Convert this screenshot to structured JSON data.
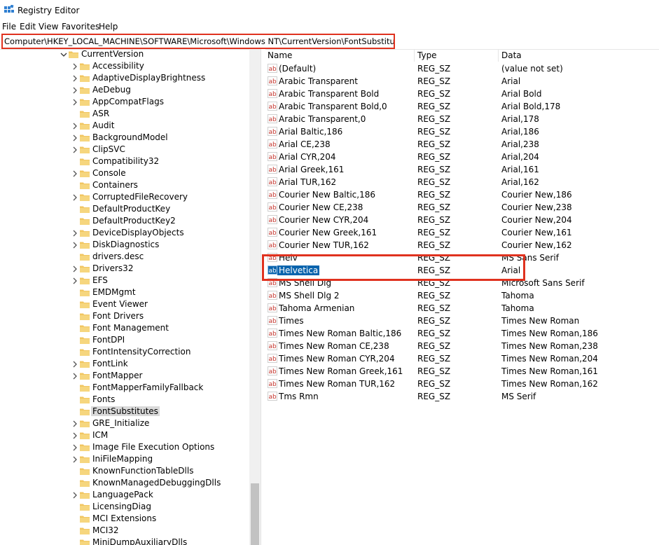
{
  "window": {
    "title": "Registry Editor"
  },
  "menu": [
    "File",
    "Edit",
    "View",
    "Favorites",
    "Help"
  ],
  "address": {
    "path": "Computer\\HKEY_LOCAL_MACHINE\\SOFTWARE\\Microsoft\\Windows NT\\CurrentVersion\\FontSubstitutes"
  },
  "tree": {
    "parent": "CurrentVersion",
    "children": [
      {
        "label": "Accessibility",
        "expandable": true
      },
      {
        "label": "AdaptiveDisplayBrightness",
        "expandable": true
      },
      {
        "label": "AeDebug",
        "expandable": true
      },
      {
        "label": "AppCompatFlags",
        "expandable": true
      },
      {
        "label": "ASR",
        "expandable": false
      },
      {
        "label": "Audit",
        "expandable": true
      },
      {
        "label": "BackgroundModel",
        "expandable": true
      },
      {
        "label": "ClipSVC",
        "expandable": true
      },
      {
        "label": "Compatibility32",
        "expandable": false
      },
      {
        "label": "Console",
        "expandable": true
      },
      {
        "label": "Containers",
        "expandable": false
      },
      {
        "label": "CorruptedFileRecovery",
        "expandable": true
      },
      {
        "label": "DefaultProductKey",
        "expandable": false
      },
      {
        "label": "DefaultProductKey2",
        "expandable": false
      },
      {
        "label": "DeviceDisplayObjects",
        "expandable": true
      },
      {
        "label": "DiskDiagnostics",
        "expandable": true
      },
      {
        "label": "drivers.desc",
        "expandable": false
      },
      {
        "label": "Drivers32",
        "expandable": true
      },
      {
        "label": "EFS",
        "expandable": true
      },
      {
        "label": "EMDMgmt",
        "expandable": false
      },
      {
        "label": "Event Viewer",
        "expandable": false
      },
      {
        "label": "Font Drivers",
        "expandable": false
      },
      {
        "label": "Font Management",
        "expandable": false
      },
      {
        "label": "FontDPI",
        "expandable": false
      },
      {
        "label": "FontIntensityCorrection",
        "expandable": false
      },
      {
        "label": "FontLink",
        "expandable": true
      },
      {
        "label": "FontMapper",
        "expandable": true
      },
      {
        "label": "FontMapperFamilyFallback",
        "expandable": false
      },
      {
        "label": "Fonts",
        "expandable": false
      },
      {
        "label": "FontSubstitutes",
        "expandable": false,
        "selected": true
      },
      {
        "label": "GRE_Initialize",
        "expandable": true
      },
      {
        "label": "ICM",
        "expandable": true
      },
      {
        "label": "Image File Execution Options",
        "expandable": true
      },
      {
        "label": "IniFileMapping",
        "expandable": true
      },
      {
        "label": "KnownFunctionTableDlls",
        "expandable": false
      },
      {
        "label": "KnownManagedDebuggingDlls",
        "expandable": false
      },
      {
        "label": "LanguagePack",
        "expandable": true
      },
      {
        "label": "LicensingDiag",
        "expandable": false
      },
      {
        "label": "MCI Extensions",
        "expandable": false
      },
      {
        "label": "MCI32",
        "expandable": false
      },
      {
        "label": "MiniDumpAuxiliaryDlls",
        "expandable": false
      }
    ]
  },
  "columns": {
    "name": "Name",
    "type": "Type",
    "data": "Data"
  },
  "values": [
    {
      "name": "(Default)",
      "type": "REG_SZ",
      "data": "(value not set)"
    },
    {
      "name": "Arabic Transparent",
      "type": "REG_SZ",
      "data": "Arial"
    },
    {
      "name": "Arabic Transparent Bold",
      "type": "REG_SZ",
      "data": "Arial Bold"
    },
    {
      "name": "Arabic Transparent Bold,0",
      "type": "REG_SZ",
      "data": "Arial Bold,178"
    },
    {
      "name": "Arabic Transparent,0",
      "type": "REG_SZ",
      "data": "Arial,178"
    },
    {
      "name": "Arial Baltic,186",
      "type": "REG_SZ",
      "data": "Arial,186"
    },
    {
      "name": "Arial CE,238",
      "type": "REG_SZ",
      "data": "Arial,238"
    },
    {
      "name": "Arial CYR,204",
      "type": "REG_SZ",
      "data": "Arial,204"
    },
    {
      "name": "Arial Greek,161",
      "type": "REG_SZ",
      "data": "Arial,161"
    },
    {
      "name": "Arial TUR,162",
      "type": "REG_SZ",
      "data": "Arial,162"
    },
    {
      "name": "Courier New Baltic,186",
      "type": "REG_SZ",
      "data": "Courier New,186"
    },
    {
      "name": "Courier New CE,238",
      "type": "REG_SZ",
      "data": "Courier New,238"
    },
    {
      "name": "Courier New CYR,204",
      "type": "REG_SZ",
      "data": "Courier New,204"
    },
    {
      "name": "Courier New Greek,161",
      "type": "REG_SZ",
      "data": "Courier New,161"
    },
    {
      "name": "Courier New TUR,162",
      "type": "REG_SZ",
      "data": "Courier New,162"
    },
    {
      "name": "Helv",
      "type": "REG_SZ",
      "data": "MS Sans Serif"
    },
    {
      "name": "Helvetica",
      "type": "REG_SZ",
      "data": "Arial",
      "highlighted": true
    },
    {
      "name": "MS Shell Dlg",
      "type": "REG_SZ",
      "data": "Microsoft Sans Serif"
    },
    {
      "name": "MS Shell Dlg 2",
      "type": "REG_SZ",
      "data": "Tahoma"
    },
    {
      "name": "Tahoma Armenian",
      "type": "REG_SZ",
      "data": "Tahoma"
    },
    {
      "name": "Times",
      "type": "REG_SZ",
      "data": "Times New Roman"
    },
    {
      "name": "Times New Roman Baltic,186",
      "type": "REG_SZ",
      "data": "Times New Roman,186"
    },
    {
      "name": "Times New Roman CE,238",
      "type": "REG_SZ",
      "data": "Times New Roman,238"
    },
    {
      "name": "Times New Roman CYR,204",
      "type": "REG_SZ",
      "data": "Times New Roman,204"
    },
    {
      "name": "Times New Roman Greek,161",
      "type": "REG_SZ",
      "data": "Times New Roman,161"
    },
    {
      "name": "Times New Roman TUR,162",
      "type": "REG_SZ",
      "data": "Times New Roman,162"
    },
    {
      "name": "Tms Rmn",
      "type": "REG_SZ",
      "data": "MS Serif"
    }
  ],
  "colors": {
    "highlight_box": "#e0321f",
    "selection": "#0a64ad",
    "folder": "#f1c661",
    "value_icon": "#c4332b"
  },
  "icons": {
    "app": "registry-editor-icon",
    "folder": "folder-icon",
    "value": "string-value-icon",
    "expand": "chevron-right-icon",
    "collapse": "chevron-down-icon"
  }
}
